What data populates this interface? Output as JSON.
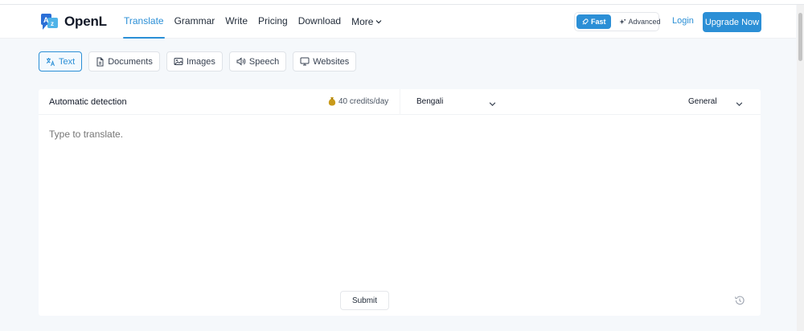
{
  "app": {
    "name": "OpenL"
  },
  "nav": {
    "items": [
      {
        "label": "Translate",
        "active": true
      },
      {
        "label": "Grammar",
        "active": false
      },
      {
        "label": "Write",
        "active": false
      },
      {
        "label": "Pricing",
        "active": false
      },
      {
        "label": "Download",
        "active": false
      }
    ],
    "more_label": "More"
  },
  "mode": {
    "fast_label": "Fast",
    "advanced_label": "Advanced",
    "selected": "Fast"
  },
  "auth": {
    "login_label": "Login",
    "upgrade_label": "Upgrade Now"
  },
  "tabs": [
    {
      "label": "Text",
      "icon": "translate-icon",
      "active": true
    },
    {
      "label": "Documents",
      "icon": "document-icon",
      "active": false
    },
    {
      "label": "Images",
      "icon": "image-icon",
      "active": false
    },
    {
      "label": "Speech",
      "icon": "speaker-icon",
      "active": false
    },
    {
      "label": "Websites",
      "icon": "monitor-icon",
      "active": false
    }
  ],
  "translator": {
    "source_language": "Automatic detection",
    "credits_label": "40 credits/day",
    "target_language": "Bengali",
    "style": "General",
    "placeholder": "Type to translate.",
    "submit_label": "Submit"
  },
  "colors": {
    "accent": "#2b8fd6",
    "background": "#f5f8fb",
    "credits_icon": "#c99a1a"
  }
}
